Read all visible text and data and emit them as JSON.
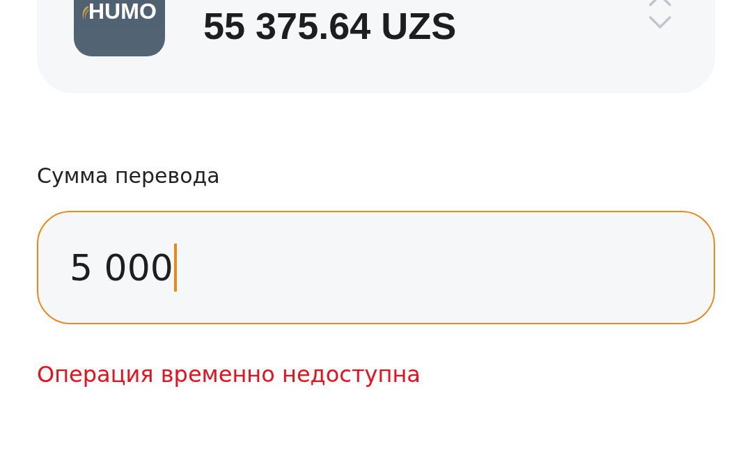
{
  "card": {
    "brand": "HUMO",
    "balance": "55 375.64 UZS"
  },
  "amount": {
    "label": "Сумма перевода",
    "value": "5 000",
    "focused": true
  },
  "error": "Операция временно недоступна"
}
